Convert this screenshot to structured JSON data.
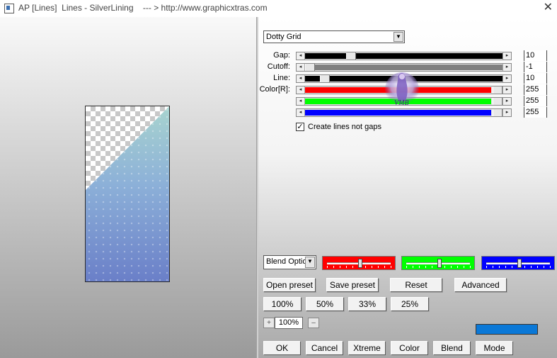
{
  "window": {
    "title": "AP [Lines]  Lines - SilverLining    --- > http://www.graphicxtras.com",
    "close_glyph": "✕"
  },
  "preset_dropdown": {
    "value": "Dotty Grid"
  },
  "sliders": [
    {
      "id": "gap",
      "label": "Gap:",
      "value": "10",
      "fill_color": "#000000",
      "fraction": 0.22
    },
    {
      "id": "cutoff",
      "label": "Cutoff:",
      "value": "-1",
      "fill_color": "#808080",
      "fraction": 0.0
    },
    {
      "id": "line",
      "label": "Line:",
      "value": "10",
      "fill_color": "#000000",
      "fraction": 0.08
    },
    {
      "id": "color_r",
      "label": "Color[R]:",
      "value": "255",
      "fill_color": "#ff0000",
      "fraction": 1.0
    },
    {
      "id": "color_g",
      "label": "",
      "value": "255",
      "fill_color": "#00ff00",
      "fraction": 1.0
    },
    {
      "id": "color_b",
      "label": "",
      "value": "255",
      "fill_color": "#0000ff",
      "fraction": 1.0
    }
  ],
  "create_lines_checkbox": {
    "label": "Create lines not gaps",
    "checked": true,
    "mark": "✓"
  },
  "blend_dropdown": {
    "value": "Blend Optio"
  },
  "channel_sliders": [
    {
      "name": "red",
      "color": "#ff0000",
      "fraction": 0.52
    },
    {
      "name": "green",
      "color": "#00ff00",
      "fraction": 0.52
    },
    {
      "name": "blue",
      "color": "#0000ff",
      "fraction": 0.52
    }
  ],
  "preset_buttons": {
    "open": "Open preset",
    "save": "Save preset",
    "reset": "Reset",
    "advanced": "Advanced"
  },
  "zoom_buttons": [
    "100%",
    "50%",
    "33%",
    "25%"
  ],
  "zoom": {
    "plus": "+",
    "value": "100%",
    "minus": "–"
  },
  "swatch_color": "#0a78d7",
  "footer_buttons": [
    "OK",
    "Cancel",
    "Xtreme",
    "Color",
    "Blend",
    "Mode"
  ]
}
